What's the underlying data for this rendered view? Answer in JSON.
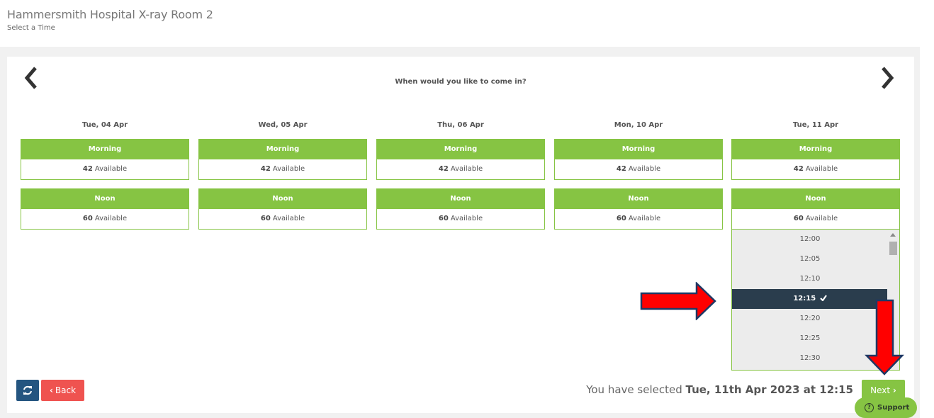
{
  "header": {
    "title": "Hammersmith Hospital X-ray Room 2",
    "subtitle": "Select a Time"
  },
  "prompt": "When would you like to come in?",
  "icons": {
    "prev": "chevron-left-icon",
    "next": "chevron-right-icon",
    "refresh": "refresh-icon",
    "check": "check-icon",
    "support": "question-circle-icon"
  },
  "colors": {
    "green": "#86c443",
    "navy": "#2a3d4d",
    "blue": "#245580",
    "red": "#ef5350",
    "annotation_red": "#ff0000"
  },
  "days": [
    {
      "label": "Tue, 04 Apr",
      "slots": [
        {
          "name": "Morning",
          "count": "42",
          "available": "Available"
        },
        {
          "name": "Noon",
          "count": "60",
          "available": "Available"
        }
      ]
    },
    {
      "label": "Wed, 05 Apr",
      "slots": [
        {
          "name": "Morning",
          "count": "42",
          "available": "Available"
        },
        {
          "name": "Noon",
          "count": "60",
          "available": "Available"
        }
      ]
    },
    {
      "label": "Thu, 06 Apr",
      "slots": [
        {
          "name": "Morning",
          "count": "42",
          "available": "Available"
        },
        {
          "name": "Noon",
          "count": "60",
          "available": "Available"
        }
      ]
    },
    {
      "label": "Mon, 10 Apr",
      "slots": [
        {
          "name": "Morning",
          "count": "42",
          "available": "Available"
        },
        {
          "name": "Noon",
          "count": "60",
          "available": "Available"
        }
      ]
    },
    {
      "label": "Tue, 11 Apr",
      "slots": [
        {
          "name": "Morning",
          "count": "42",
          "available": "Available"
        },
        {
          "name": "Noon",
          "count": "60",
          "available": "Available"
        }
      ]
    }
  ],
  "times": [
    "12:00",
    "12:05",
    "12:10",
    "12:15",
    "12:20",
    "12:25",
    "12:30"
  ],
  "selected_time": "12:15",
  "footer": {
    "back_label": "Back",
    "selected_prefix": "You have selected",
    "selected_value": "Tue, 11th Apr 2023 at 12:15",
    "next_label": "Next",
    "support_label": "Support"
  }
}
